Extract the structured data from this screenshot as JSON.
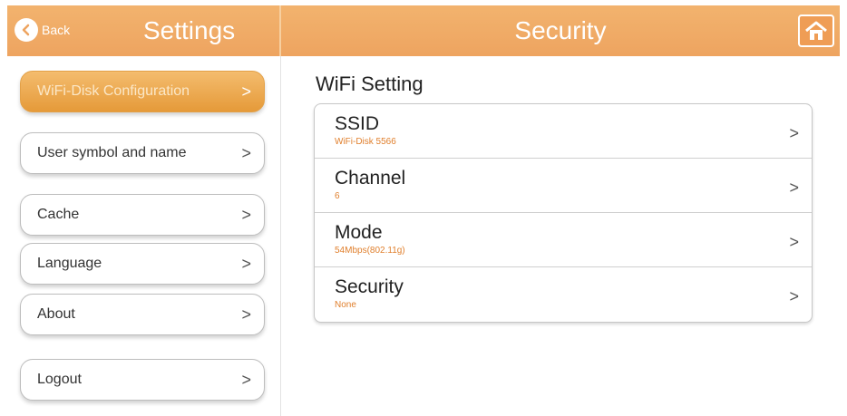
{
  "header": {
    "back_label": "Back",
    "settings_title": "Settings",
    "page_title": "Security"
  },
  "sidebar": {
    "items": [
      {
        "label": "WiFi-Disk Configuration",
        "active": true
      },
      {
        "label": "User symbol and name",
        "active": false
      },
      {
        "label": "Cache",
        "active": false
      },
      {
        "label": "Language",
        "active": false
      },
      {
        "label": "About",
        "active": false
      },
      {
        "label": "Logout",
        "active": false
      }
    ],
    "chevron": ">"
  },
  "main": {
    "section_title": "WiFi Setting",
    "rows": [
      {
        "label": "SSID",
        "value": "WiFi-Disk 5566"
      },
      {
        "label": "Channel",
        "value": "6"
      },
      {
        "label": "Mode",
        "value": "54Mbps(802.11g)"
      },
      {
        "label": "Security",
        "value": "None"
      }
    ]
  },
  "colors": {
    "accent": "#eea460",
    "value_text": "#e07f2c"
  },
  "icons": {
    "back": "back-arrow-icon",
    "home": "home-icon",
    "chevron": "chevron-right-icon"
  }
}
